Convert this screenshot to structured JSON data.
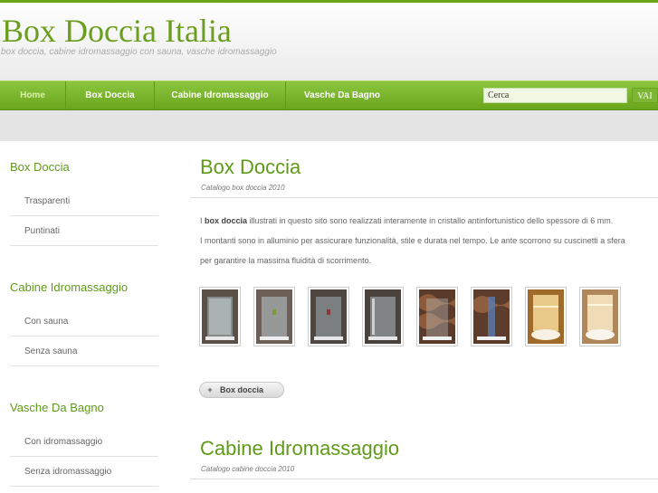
{
  "site": {
    "title": "Box Doccia Italia",
    "tagline": "box doccia, cabine idromassaggio con sauna, vasche idromassaggio"
  },
  "nav": {
    "items": [
      {
        "label": "Home"
      },
      {
        "label": "Box Doccia"
      },
      {
        "label": "Cabine Idromassaggio"
      },
      {
        "label": "Vasche Da Bagno"
      }
    ],
    "search_placeholder": "Cerca",
    "search_button": "VAI"
  },
  "sidebar": {
    "sections": [
      {
        "heading": "Box Doccia",
        "items": [
          "Trasparenti",
          "Puntinati"
        ]
      },
      {
        "heading": "Cabine Idromassaggio",
        "items": [
          "Con sauna",
          "Senza sauna"
        ]
      },
      {
        "heading": "Vasche Da Bagno",
        "items": [
          "Con idromassaggio",
          "Senza idromassaggio"
        ]
      }
    ]
  },
  "main": {
    "section1": {
      "title": "Box Doccia",
      "subtitle": "Catalogo box doccia 2010",
      "para_prefix": "I ",
      "para_bold": "box doccia",
      "para_line1": " illustrati in questo sito sono realizzati interamente in cristallo antinfortunistico dello spessore di 6 mm.",
      "para_line2": "I montanti sono in alluminio per assicurare funzionalità, stile e durata nel tempo. Le ante scorrono su cuscinetti a sfera",
      "para_line3": "per garantire la massima fluidità di scorrimento.",
      "more_button": "Box doccia",
      "more_icon": "+"
    },
    "section2": {
      "title": "Cabine Idromassaggio",
      "subtitle": "Catalogo cabine doccia 2010"
    }
  },
  "colors": {
    "brand_green": "#6aa51c",
    "title_green": "#5f9a18"
  }
}
